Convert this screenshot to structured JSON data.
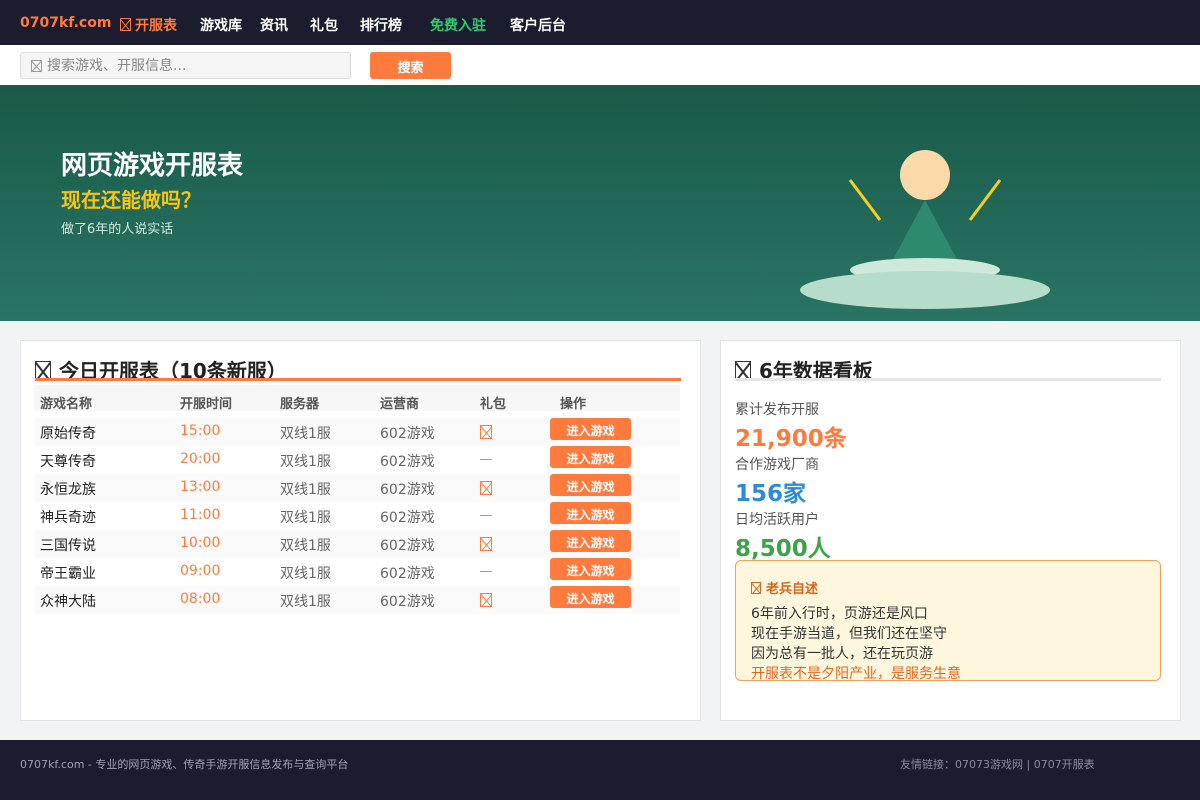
{
  "colors": {
    "accent": "#ff7a3d",
    "highlight_green": "#2ecc71",
    "hero_bg": "#195a49",
    "hero_yellow": "#f5c518",
    "stat_blue": "#2c8ad6",
    "stat_green": "#3fa24a",
    "nav_bg": "#1b1d2e"
  },
  "nav": {
    "logo": "0707kf.com",
    "items": [
      {
        "label": "开服表",
        "icon": "box-x-icon",
        "active": true
      },
      {
        "label": "游戏库"
      },
      {
        "label": "资讯"
      },
      {
        "label": "礼包"
      },
      {
        "label": "排行榜"
      },
      {
        "label": "免费入驻",
        "highlight": true
      },
      {
        "label": "客户后台"
      }
    ]
  },
  "search": {
    "placeholder": "搜索游戏、开服信息...",
    "button_label": "搜索",
    "icon": "box-x-icon"
  },
  "hero": {
    "title": "网页游戏开服表",
    "subtitle": "现在还能做吗？",
    "desc": "做了6年的人说实话"
  },
  "server_table": {
    "title": "今日开服表（10条新服）",
    "headers": [
      "游戏名称",
      "开服时间",
      "服务器",
      "运营商",
      "礼包",
      "操作"
    ],
    "rows": [
      {
        "name": "原始传奇",
        "time": "15:00",
        "server": "双线1服",
        "operator": "602游戏",
        "gift": true,
        "action": "进入游戏"
      },
      {
        "name": "天尊传奇",
        "time": "20:00",
        "server": "双线1服",
        "operator": "602游戏",
        "gift": false,
        "action": "进入游戏"
      },
      {
        "name": "永恒龙族",
        "time": "13:00",
        "server": "双线1服",
        "operator": "602游戏",
        "gift": true,
        "action": "进入游戏"
      },
      {
        "name": "神兵奇迹",
        "time": "11:00",
        "server": "双线1服",
        "operator": "602游戏",
        "gift": false,
        "action": "进入游戏"
      },
      {
        "name": "三国传说",
        "time": "10:00",
        "server": "双线1服",
        "operator": "602游戏",
        "gift": true,
        "action": "进入游戏"
      },
      {
        "name": "帝王霸业",
        "time": "09:00",
        "server": "双线1服",
        "operator": "602游戏",
        "gift": false,
        "action": "进入游戏"
      },
      {
        "name": "众神大陆",
        "time": "08:00",
        "server": "双线1服",
        "operator": "602游戏",
        "gift": true,
        "action": "进入游戏"
      }
    ]
  },
  "dashboard": {
    "title": "6年数据看板",
    "stats": [
      {
        "label": "累计发布开服",
        "value": "21,900条",
        "color": "#ff7a3d"
      },
      {
        "label": "合作游戏厂商",
        "value": "156家",
        "color": "#2c8ad6"
      },
      {
        "label": "日均活跃用户",
        "value": "8,500人",
        "color": "#3fa24a"
      }
    ],
    "note": {
      "title": "老兵自述",
      "lines": [
        "6年前入行时，页游还是风口",
        "现在手游当道，但我们还在坚守",
        "因为总有一批人，还在玩页游"
      ],
      "highlight": "开服表不是夕阳产业，是服务生意"
    }
  },
  "footer": {
    "left": "0707kf.com - 专业的网页游戏、传奇手游开服信息发布与查询平台",
    "right": "友情链接：07073游戏网 | 0707开服表"
  }
}
